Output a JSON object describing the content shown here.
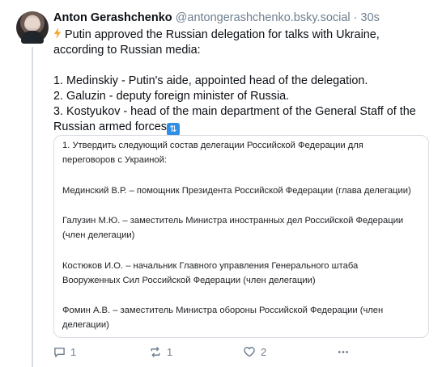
{
  "post": {
    "author_name": "Anton Gerashchenko",
    "author_handle": "@antongerashchenko.bsky.social",
    "separator": "·",
    "time": "30s",
    "text_lines": [
      "Putin approved the Russian delegation for talks with Ukraine,",
      "according to Russian media:",
      "",
      "1. Medinskiy - Putin's aide, appointed head of the delegation.",
      "2. Galuzin - deputy foreign minister of Russia.",
      "3. Kostyukov - head of the main department of the General Staff of the",
      "Russian armed forces"
    ],
    "bolt_icon": "lightning-bolt-emoji",
    "updown_icon": "up-down-arrow-emoji",
    "updown_glyph": "⇅"
  },
  "document": {
    "paragraphs": [
      [
        "1. Утвердить следующий состав делегации Российской Федерации для",
        "переговоров с Украиной:"
      ],
      [
        "Мединский В.Р. – помощник Президента Российской Федерации (глава делегации)"
      ],
      [
        "Галузин М.Ю. – заместитель Министра иностранных дел Российской Федерации",
        "(член делегации)"
      ],
      [
        "Костюков И.О. – начальник Главного управления Генерального штаба",
        "Вооруженных Сил Российской Федерации (член делегации)"
      ],
      [
        "Фомин А.В. – заместитель Министра обороны Российской Федерации (член",
        "делегации)"
      ]
    ]
  },
  "actions": {
    "reply_count": "1",
    "repost_count": "1",
    "like_count": "2"
  },
  "colors": {
    "accent": "#2f8ee6",
    "muted": "#6f7f8f",
    "border": "#d8dde3"
  }
}
